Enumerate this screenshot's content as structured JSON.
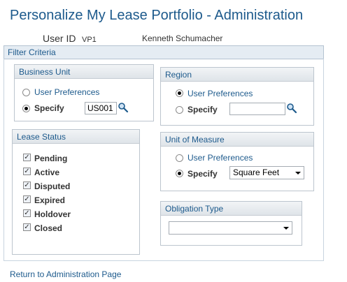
{
  "page": {
    "title": "Personalize My Lease Portfolio - Administration",
    "user_id_label": "User ID",
    "user_id": "VP1",
    "user_name": "Kenneth Schumacher"
  },
  "filter_criteria": {
    "label": "Filter Criteria",
    "business_unit": {
      "title": "Business Unit",
      "user_preferences_label": "User Preferences",
      "specify_label": "Specify",
      "selected": "specify",
      "value": "US001"
    },
    "region": {
      "title": "Region",
      "user_preferences_label": "User Preferences",
      "specify_label": "Specify",
      "selected": "user_preferences",
      "value": ""
    },
    "lease_status": {
      "title": "Lease Status",
      "items": [
        {
          "label": "Pending",
          "checked": true
        },
        {
          "label": "Active",
          "checked": true
        },
        {
          "label": "Disputed",
          "checked": true
        },
        {
          "label": "Expired",
          "checked": true
        },
        {
          "label": "Holdover",
          "checked": true
        },
        {
          "label": "Closed",
          "checked": true
        }
      ]
    },
    "unit_of_measure": {
      "title": "Unit of Measure",
      "user_preferences_label": "User Preferences",
      "specify_label": "Specify",
      "selected": "specify",
      "value": "Square Feet"
    },
    "obligation_type": {
      "title": "Obligation Type",
      "value": ""
    }
  },
  "footer": {
    "return_link": "Return to Administration Page"
  },
  "colors": {
    "accent": "#1d5a8c",
    "header_bg": "#e5ecf3"
  }
}
